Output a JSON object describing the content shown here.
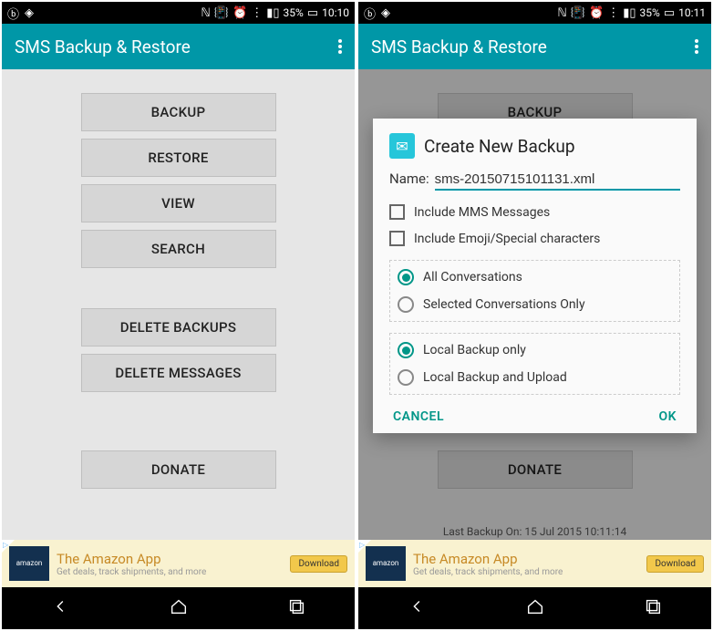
{
  "status": {
    "battery": "35%",
    "time_left": "10:10",
    "time_right": "10:11"
  },
  "app": {
    "title": "SMS Backup & Restore"
  },
  "buttons": {
    "backup": "BACKUP",
    "restore": "RESTORE",
    "view": "VIEW",
    "search": "SEARCH",
    "delete_backups": "DELETE BACKUPS",
    "delete_messages": "DELETE MESSAGES",
    "donate": "DONATE"
  },
  "ad": {
    "logo": "amazon",
    "title": "The Amazon App",
    "subtitle": "Get deals, track shipments, and more",
    "cta": "Download"
  },
  "dialog": {
    "title": "Create New Backup",
    "name_label": "Name:",
    "name_value": "sms-20150715101131.xml",
    "include_mms": "Include MMS Messages",
    "include_emoji": "Include Emoji/Special characters",
    "all_conv": "All Conversations",
    "sel_conv": "Selected Conversations Only",
    "local_only": "Local Backup only",
    "local_upload": "Local Backup and Upload",
    "cancel": "CANCEL",
    "ok": "OK"
  },
  "last_backup": "Last Backup On: 15 Jul 2015 10:11:14"
}
